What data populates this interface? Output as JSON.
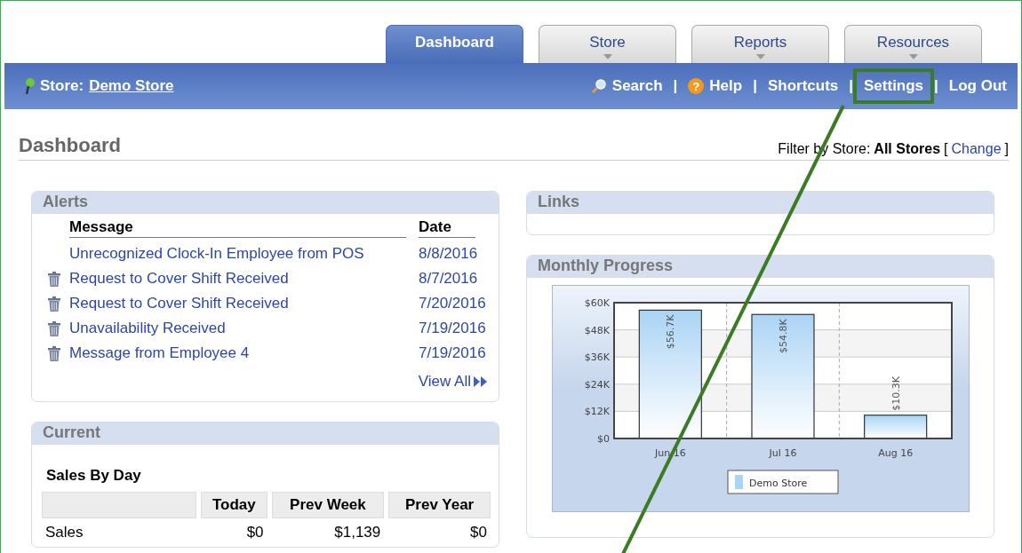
{
  "tabs": [
    {
      "label": "Dashboard",
      "selected": true,
      "dropdown": false
    },
    {
      "label": "Store",
      "selected": false,
      "dropdown": true
    },
    {
      "label": "Reports",
      "selected": false,
      "dropdown": true
    },
    {
      "label": "Resources",
      "selected": false,
      "dropdown": true
    }
  ],
  "store_bar": {
    "label": "Store:",
    "store": "Demo Store"
  },
  "nav_links": [
    {
      "label": "Search",
      "highlighted": false
    },
    {
      "label": "Help",
      "badge": "?",
      "highlighted": false
    },
    {
      "label": "Shortcuts",
      "highlighted": false
    },
    {
      "label": "Settings",
      "highlighted": true
    },
    {
      "label": "Log Out",
      "highlighted": false
    }
  ],
  "separator": "|",
  "page_title": "Dashboard",
  "filter": {
    "label": "Filter by Store:",
    "value": "All Stores",
    "open_bracket": "[",
    "link": "Change",
    "close_bracket": "]"
  },
  "alerts": {
    "title": "Alerts",
    "columns": [
      "Message",
      "Date"
    ],
    "rows": [
      {
        "message": "Unrecognized Clock-In Employee from POS",
        "date": "8/8/2016",
        "deletable": false
      },
      {
        "message": "Request to Cover Shift Received",
        "date": "8/7/2016",
        "deletable": true
      },
      {
        "message": "Request to Cover Shift Received",
        "date": "7/20/2016",
        "deletable": true
      },
      {
        "message": "Unavailability Received",
        "date": "7/19/2016",
        "deletable": true
      },
      {
        "message": "Message from Employee 4",
        "date": "7/19/2016",
        "deletable": true
      }
    ],
    "view_all": "View All"
  },
  "current": {
    "title": "Current",
    "subtitle": "Sales By Day",
    "columns": [
      "",
      "Today",
      "Prev Week",
      "Prev Year"
    ],
    "rows": [
      [
        "Sales",
        "$0",
        "$1,139",
        "$0"
      ]
    ]
  },
  "links": {
    "title": "Links"
  },
  "monthly_progress": {
    "title": "Monthly Progress",
    "chart_data": {
      "type": "bar",
      "categories": [
        "Jun 16",
        "Jul 16",
        "Aug 16"
      ],
      "series": [
        {
          "name": "Demo Store",
          "color": "#aad4f5",
          "values": [
            56700,
            54800,
            10300
          ]
        }
      ],
      "ylim": [
        0,
        60000
      ],
      "grid": true,
      "yticks": [
        {
          "value": 0,
          "label": "$0"
        },
        {
          "value": 12000,
          "label": "$12K"
        },
        {
          "value": 24000,
          "label": "$24K"
        },
        {
          "value": 36000,
          "label": "$36K"
        },
        {
          "value": 48000,
          "label": "$48K"
        },
        {
          "value": 60000,
          "label": "$60K"
        }
      ],
      "value_labels": [
        "$56.7K",
        "$54.8K",
        "$10.3K"
      ]
    }
  }
}
